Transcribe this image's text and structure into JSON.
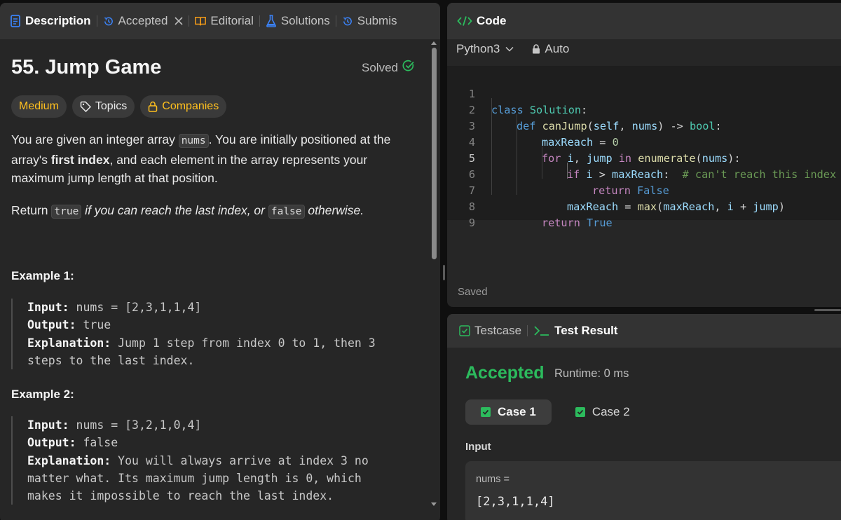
{
  "left_tabs": [
    {
      "label": "Description"
    },
    {
      "label": "Accepted"
    },
    {
      "label": "Editorial"
    },
    {
      "label": "Solutions"
    },
    {
      "label": "Submis"
    }
  ],
  "problem": {
    "title": "55. Jump Game",
    "status": "Solved",
    "difficulty": "Medium",
    "topics_label": "Topics",
    "companies_label": "Companies",
    "para1_a": "You are given an integer array ",
    "para1_code": "nums",
    "para1_b": ". You are initially positioned at the array's ",
    "para1_bold": "first index",
    "para1_c": ", and each element in the array represents your maximum jump length at that position.",
    "para2_a": "Return ",
    "para2_code1": "true",
    "para2_b": " if you can reach the last index, or ",
    "para2_code2": "false",
    "para2_c": " otherwise."
  },
  "examples": [
    {
      "title": "Example 1:",
      "input_label": "Input:",
      "input": " nums = [2,3,1,1,4]",
      "output_label": "Output:",
      "output": " true",
      "expl_label": "Explanation:",
      "expl_1": " Jump 1 step from index 0 to 1, then 3",
      "expl_2": "steps to the last index."
    },
    {
      "title": "Example 2:",
      "input_label": "Input:",
      "input": " nums = [3,2,1,0,4]",
      "output_label": "Output:",
      "output": " false",
      "expl_label": "Explanation:",
      "expl_1": " You will always arrive at index 3 no",
      "expl_2": "matter what. Its maximum jump length is 0, which",
      "expl_3": "makes it impossible to reach the last index."
    }
  ],
  "code_panel": {
    "title": "Code",
    "language": "Python3",
    "autocomplete": "Auto",
    "saved_status": "Saved",
    "line_numbers": [
      "1",
      "2",
      "3",
      "4",
      "5",
      "6",
      "7",
      "8",
      "9"
    ],
    "current_line": "5"
  },
  "code_tokens": {
    "l1": [
      "class",
      " ",
      "Solution",
      ":"
    ],
    "l2": [
      "def",
      " ",
      "canJump",
      "(",
      "self",
      ", ",
      "nums",
      ") -> ",
      "bool",
      ":"
    ],
    "l3": [
      "maxReach",
      " = ",
      "0"
    ],
    "l4": [
      "for",
      " ",
      "i",
      ", ",
      "jump",
      " ",
      "in",
      " ",
      "enumerate",
      "(",
      "nums",
      "):"
    ],
    "l5": [
      "if",
      " ",
      "i",
      " > ",
      "maxReach",
      ":  ",
      "# can't reach this index"
    ],
    "l6": [
      "return",
      " ",
      "False"
    ],
    "l7": [
      "maxReach",
      " = ",
      "max",
      "(",
      "maxReach",
      ", ",
      "i",
      " + ",
      "jump",
      ")"
    ],
    "l8": [
      "return",
      " ",
      "True"
    ]
  },
  "result_panel": {
    "tab_testcase": "Testcase",
    "tab_result": "Test Result",
    "verdict": "Accepted",
    "runtime": "Runtime: 0 ms",
    "cases": [
      {
        "label": "Case 1"
      },
      {
        "label": "Case 2"
      }
    ],
    "input_label": "Input",
    "input_var": "nums =",
    "input_value": "[2,3,1,1,4]"
  },
  "colors": {
    "accent_green": "#2cbb5d",
    "medium_yellow": "#ffc01e",
    "description_blue": "#3b82f6",
    "panel_bg": "#262626",
    "tabbar_bg": "#333333"
  },
  "icons": {
    "description": "document-icon",
    "accepted": "history-icon",
    "editorial": "book-icon",
    "solutions": "flask-icon",
    "submissions": "history-icon",
    "code": "code-brackets-icon",
    "lock": "lock-icon",
    "testcase": "checkbox-icon",
    "test_result": "terminal-icon"
  }
}
